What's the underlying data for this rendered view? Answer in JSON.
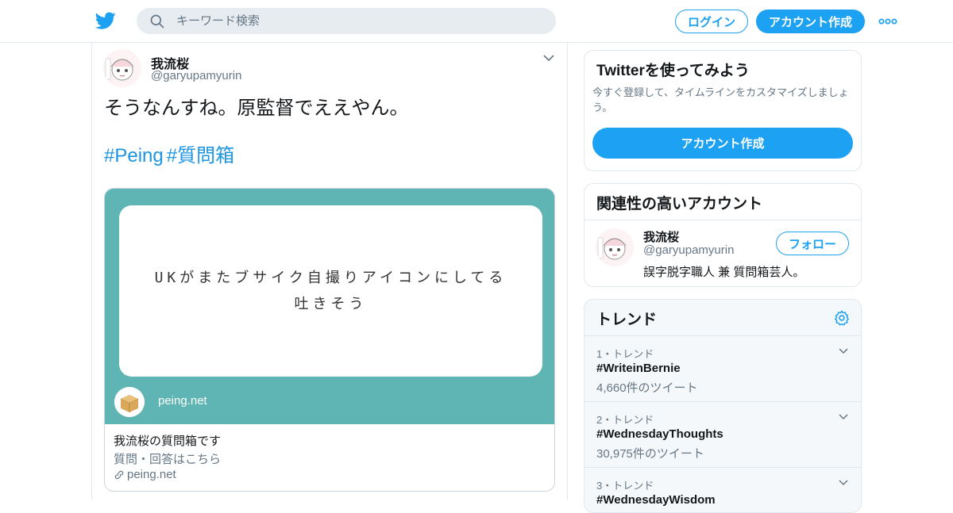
{
  "header": {
    "search_placeholder": "キーワード検索",
    "login_label": "ログイン",
    "signup_label": "アカウント作成",
    "brand_color": "#1da1f2"
  },
  "tweet": {
    "display_name": "我流桜",
    "handle": "@garyupamyurin",
    "text": "そうなんすね。原監督でええやん。",
    "hashtags": [
      "#Peing",
      "#質問箱"
    ],
    "card": {
      "question_line1": "UKがまたブサイク自撮りアイコンにしてる",
      "question_line2": "吐きそう",
      "site_label": "peing.net",
      "title": "我流桜の質問箱です",
      "description": "質問・回答はこちら",
      "link": "peing.net",
      "bg_color": "#5eb5b3"
    }
  },
  "sidebar": {
    "signup_module": {
      "title": "Twitterを使ってみよう",
      "text": "今すぐ登録して、タイムラインをカスタマイズしましょう。",
      "button_label": "アカウント作成"
    },
    "related": {
      "title": "関連性の高いアカウント",
      "account": {
        "display_name": "我流桜",
        "handle": "@garyupamyurin",
        "bio": "誤字脱字職人 兼 質問箱芸人。",
        "follow_label": "フォロー"
      }
    },
    "trends": {
      "title": "トレンド",
      "items": [
        {
          "meta": "1・トレンド",
          "tag": "#WriteinBernie",
          "count": "4,660件のツイート"
        },
        {
          "meta": "2・トレンド",
          "tag": "#WednesdayThoughts",
          "count": "30,975件のツイート"
        },
        {
          "meta": "3・トレンド",
          "tag": "#WednesdayWisdom",
          "count": ""
        }
      ]
    }
  }
}
